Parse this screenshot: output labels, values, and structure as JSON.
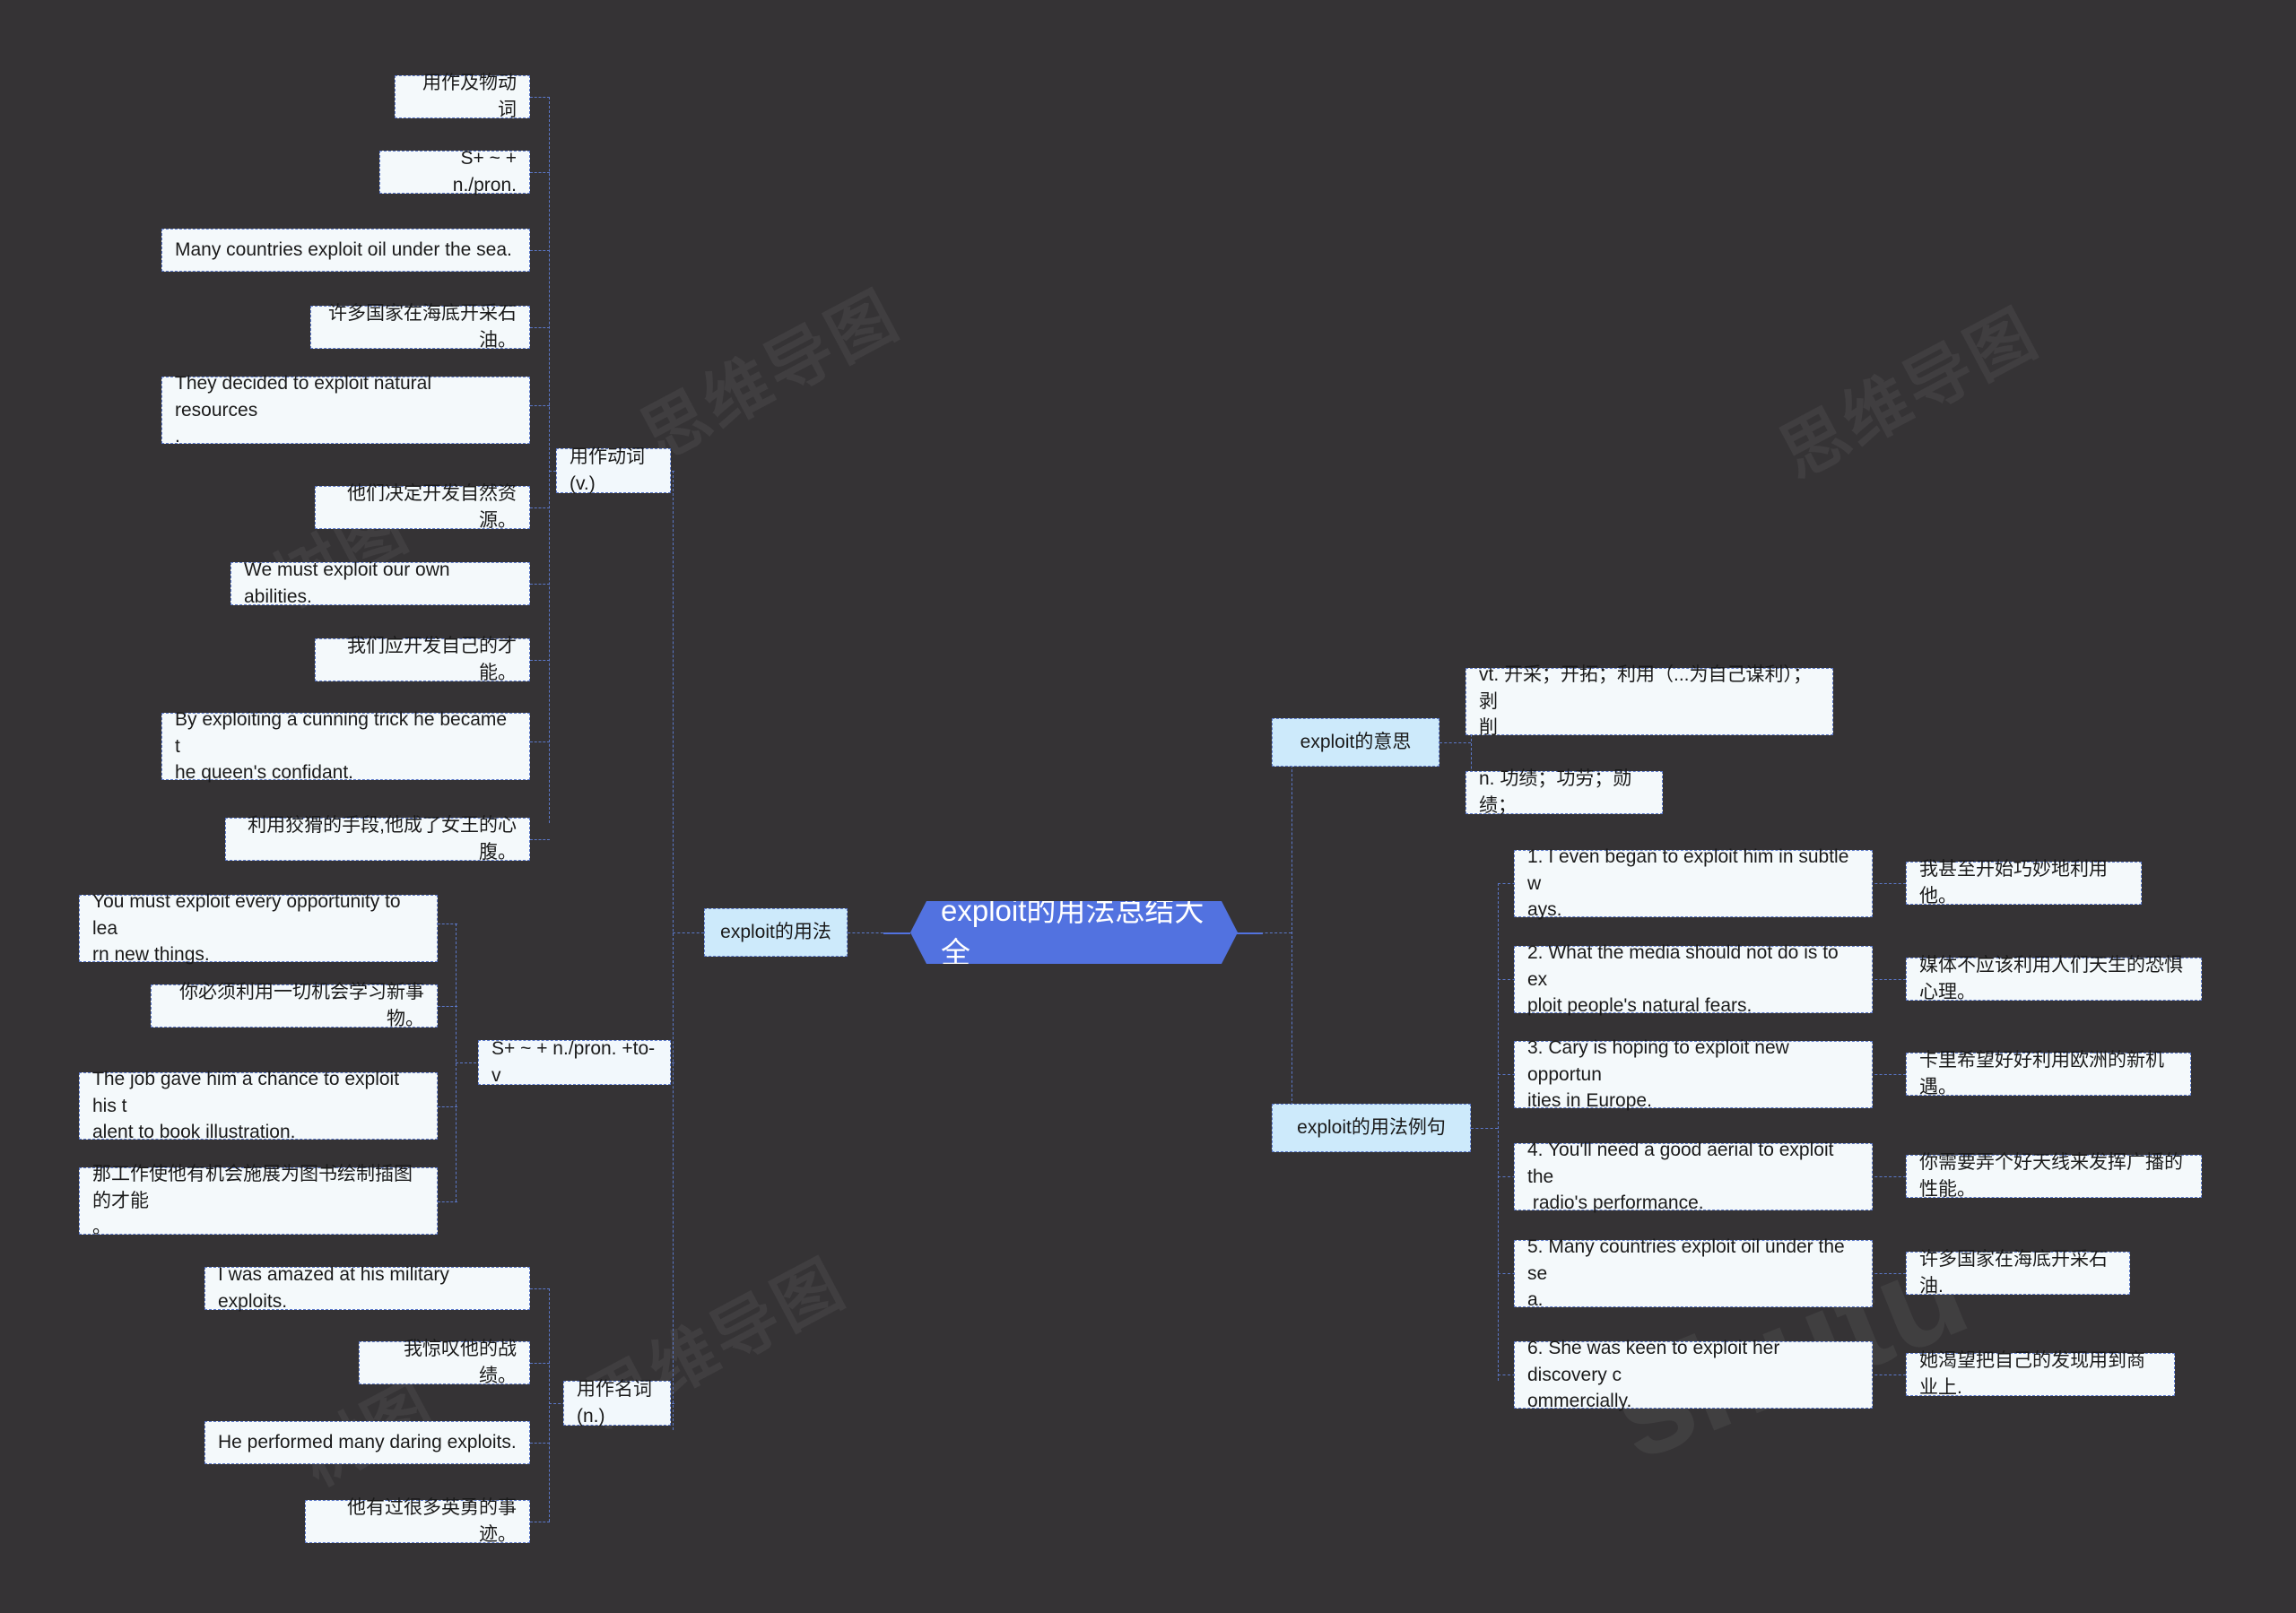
{
  "center": {
    "label": "exploit的用法总结大全"
  },
  "branches": {
    "usage": {
      "label": "exploit的用法"
    },
    "meaning": {
      "label": "exploit的意思"
    },
    "examples": {
      "label": "exploit的用法例句"
    }
  },
  "usage_subbranches": {
    "verb": {
      "label": "用作动词(v.)"
    },
    "pattern_to_v": {
      "label": "S+ ~ + n./pron. +to- v"
    },
    "noun": {
      "label": "用作名词(n.)"
    }
  },
  "verb_children": [
    {
      "label": "用作及物动词"
    },
    {
      "label": "S+ ~ + n./pron."
    },
    {
      "label": "Many countries exploit oil under the sea."
    },
    {
      "label": "许多国家在海底开采石油。"
    },
    {
      "label": "They decided to exploit natural resources\n."
    },
    {
      "label": "他们决定开发自然资源。"
    },
    {
      "label": "We must exploit our own abilities."
    },
    {
      "label": "我们应开发自己的才能。"
    },
    {
      "label": "By exploiting a cunning trick he became t\nhe queen's confidant."
    },
    {
      "label": "利用狡猾的手段,他成了女王的心腹。"
    }
  ],
  "pattern_children": [
    {
      "label": "You must exploit every opportunity to lea\nrn new things."
    },
    {
      "label": "你必须利用一切机会学习新事物。"
    },
    {
      "label": "The job gave him a chance to exploit his t\nalent to book illustration."
    },
    {
      "label": "那工作使他有机会施展为图书绘制插图的才能\n。"
    }
  ],
  "noun_children": [
    {
      "label": "I was amazed at his military exploits."
    },
    {
      "label": "我惊叹他的战绩。"
    },
    {
      "label": "He performed many daring exploits."
    },
    {
      "label": "他有过很多英勇的事迹。"
    }
  ],
  "meaning_children": [
    {
      "label": "vt. 开采；开拓；利用（...为自己谋利）；剥\n削"
    },
    {
      "label": "n. 功绩；功劳；勋绩；"
    }
  ],
  "example_rows": [
    {
      "en": "1. I even began to exploit him in subtle w\nays.",
      "cn": "我甚至开始巧妙地利用他。"
    },
    {
      "en": "2. What the media should not do is to ex\nploit people's natural fears.",
      "cn": "媒体不应该利用人们天生的恐惧心理。"
    },
    {
      "en": "3. Cary is hoping to exploit new opportun\nities in Europe.",
      "cn": "卡里希望好好利用欧洲的新机遇。"
    },
    {
      "en": "4. You'll need a good aerial to exploit the\n radio's performance.",
      "cn": "你需要弄个好天线来发挥广播的性能。"
    },
    {
      "en": "5. Many countries exploit oil under the se\na.",
      "cn": "许多国家在海底开采石油."
    },
    {
      "en": "6. She was keen to exploit her discovery c\nommercially.",
      "cn": "她渴望把自己的发现用到商业上."
    }
  ],
  "watermarks": [
    "树图",
    "思维导图",
    "shutu"
  ],
  "colors": {
    "background": "#353335",
    "center_fill": "#5272e0",
    "branch_fill": "#cdeafb",
    "leaf_fill": "#f4f9fb",
    "line": "#5b78c9"
  }
}
